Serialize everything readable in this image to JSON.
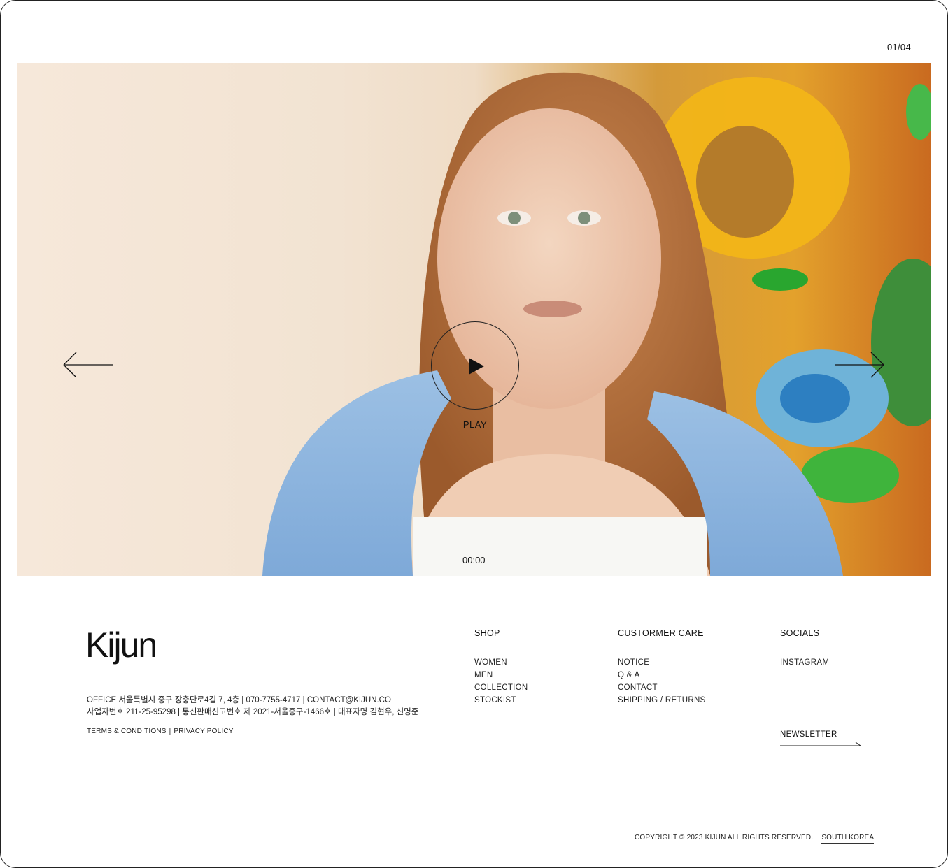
{
  "slider": {
    "counter": "01/04",
    "play_label": "PLAY",
    "timecode": "00:00",
    "prev_icon": "arrow-left-icon",
    "next_icon": "arrow-right-icon"
  },
  "footer": {
    "logo": "Kijun",
    "office_line1": "OFFICE  서울특별시 중구 장충단로4길 7, 4층 | 070-7755-4717 | CONTACT@KIJUN.CO",
    "office_line2": "사업자번호 211-25-95298 | 통신판매신고번호 제 2021-서울중구-1466호 | 대표자명 김현우, 신명준",
    "terms": "TERMS & CONDITIONS",
    "separator": "|",
    "privacy": "PRIVACY POLICY",
    "shop": {
      "heading": "SHOP",
      "items": [
        "WOMEN",
        "MEN",
        "COLLECTION",
        "STOCKIST"
      ]
    },
    "care": {
      "heading": "CUSTORMER CARE",
      "items": [
        "NOTICE",
        "Q & A",
        "CONTACT",
        "SHIPPING / RETURNS"
      ]
    },
    "socials": {
      "heading": "SOCIALS",
      "items": [
        "INSTAGRAM"
      ]
    },
    "newsletter": "NEWSLETTER",
    "copyright": "COPYRIGHT © 2023 KIJUN ALL RIGHTS RESERVED.",
    "region": "SOUTH KOREA"
  },
  "colors": {
    "text": "#111111",
    "rule": "#9a9a9a",
    "background": "#ffffff"
  }
}
